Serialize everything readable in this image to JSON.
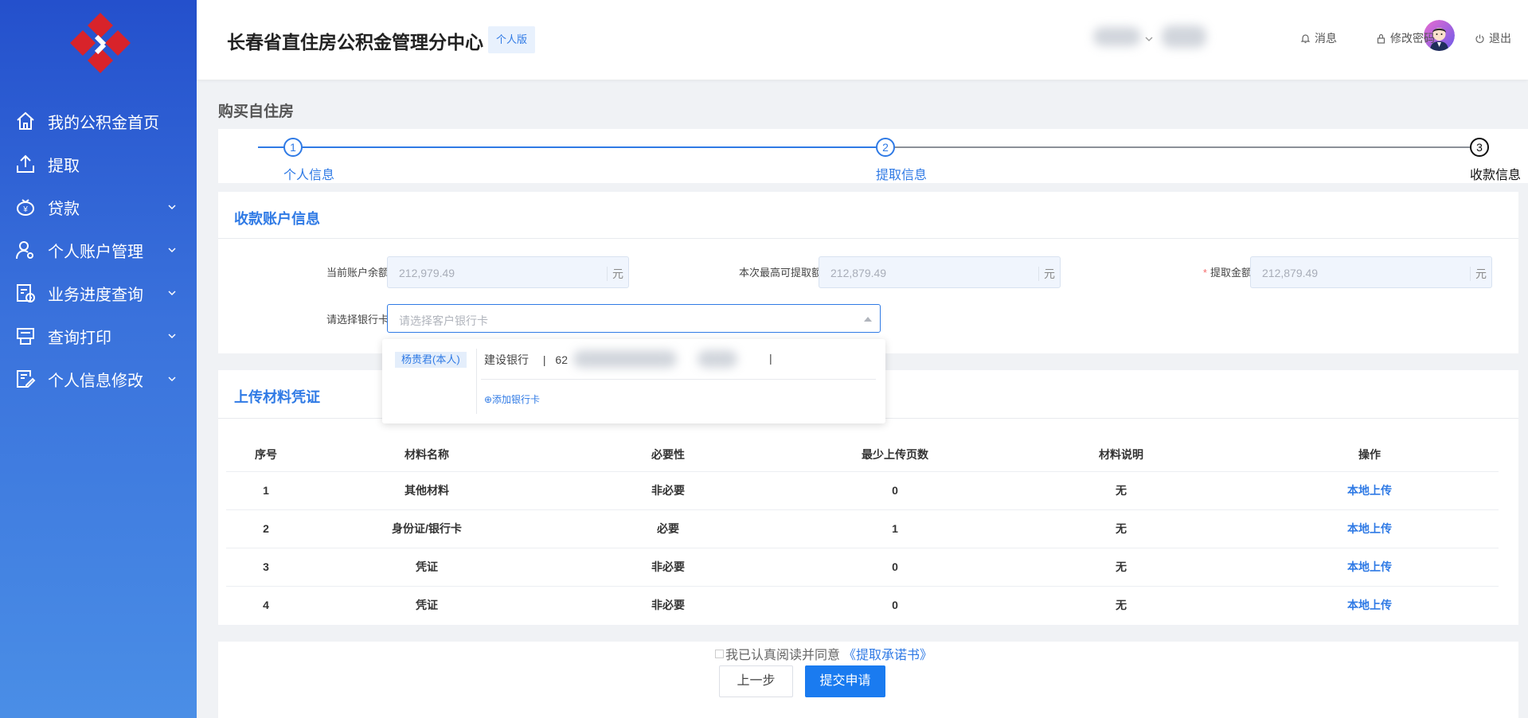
{
  "sidebar": {
    "items": [
      {
        "label": "我的公积金首页",
        "icon": "home-icon",
        "has_children": false
      },
      {
        "label": "提取",
        "icon": "upload-icon",
        "has_children": false
      },
      {
        "label": "贷款",
        "icon": "money-bag-icon",
        "has_children": true
      },
      {
        "label": "个人账户管理",
        "icon": "user-settings-icon",
        "has_children": true
      },
      {
        "label": "业务进度查询",
        "icon": "progress-doc-icon",
        "has_children": true
      },
      {
        "label": "查询打印",
        "icon": "printer-icon",
        "has_children": true
      },
      {
        "label": "个人信息修改",
        "icon": "edit-doc-icon",
        "has_children": true
      }
    ]
  },
  "header": {
    "title": "长春省直住房公积金管理分中心",
    "badge": "个人版",
    "messages": "消息",
    "change_password": "修改密码",
    "logout": "退出"
  },
  "page": {
    "title": "购买自住房"
  },
  "steps": [
    {
      "num": "1",
      "label": "个人信息",
      "state": "done"
    },
    {
      "num": "2",
      "label": "提取信息",
      "state": "active"
    },
    {
      "num": "3",
      "label": "收款信息",
      "state": "idle"
    }
  ],
  "account": {
    "section_title": "收款账户信息",
    "balance_label": "当前账户余额",
    "balance_value": "212,979.49",
    "max_label": "本次最高可提取额",
    "max_value": "212,879.49",
    "amount_label": "提取金额",
    "amount_value": "212,879.49",
    "unit": "元",
    "bank_label": "请选择银行卡",
    "bank_placeholder": "请选择客户银行卡"
  },
  "dropdown": {
    "holder_tag": "杨贵君(本人)",
    "bank_name": "建设银行",
    "sep": "|",
    "card_prefix": "62",
    "add_card": "⊕添加银行卡"
  },
  "materials": {
    "section_title": "上传材料凭证",
    "headers": [
      "序号",
      "材料名称",
      "必要性",
      "最少上传页数",
      "材料说明",
      "操作"
    ],
    "rows": [
      {
        "no": "1",
        "name": "其他材料",
        "required": "非必要",
        "min_pages": "0",
        "desc": "无",
        "action": "本地上传"
      },
      {
        "no": "2",
        "name": "身份证/银行卡",
        "required": "必要",
        "min_pages": "1",
        "desc": "无",
        "action": "本地上传"
      },
      {
        "no": "3",
        "name": "凭证",
        "required": "非必要",
        "min_pages": "0",
        "desc": "无",
        "action": "本地上传"
      },
      {
        "no": "4",
        "name": "凭证",
        "required": "非必要",
        "min_pages": "0",
        "desc": "无",
        "action": "本地上传"
      }
    ]
  },
  "footer": {
    "agree_text": "我已认真阅读并同意",
    "agree_link": "《提取承诺书》",
    "prev_button": "上一步",
    "submit_button": "提交申请"
  },
  "colors": {
    "primary": "#2f7ae5",
    "sidebar_top": "#2450cc",
    "sidebar_bottom": "#4a8ee6",
    "logo_red": "#d8232a"
  }
}
